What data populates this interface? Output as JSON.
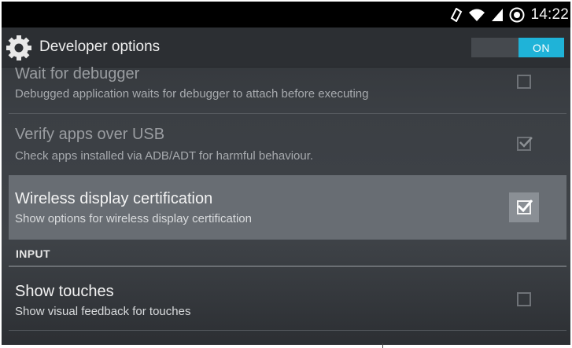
{
  "status_bar": {
    "time": "14:22",
    "icons": [
      "nfc-icon",
      "wifi-icon",
      "signal-icon",
      "sim-icon"
    ]
  },
  "action_bar": {
    "title": "Developer options",
    "icon": "gear-icon",
    "toggle_label": "ON",
    "toggle_state": "on",
    "accent_color": "#1fb3d8"
  },
  "settings": [
    {
      "title": "Wait for debugger",
      "summary": "Debugged application waits for debugger to attach before executing",
      "checked": false,
      "enabled": false
    },
    {
      "title": "Verify apps over USB",
      "summary": "Check apps installed via ADB/ADT for harmful behaviour.",
      "checked": true,
      "enabled": false
    },
    {
      "title": "Wireless display certification",
      "summary": "Show options for wireless display certification",
      "checked": true,
      "enabled": true,
      "highlighted": true
    }
  ],
  "section": {
    "header": "INPUT"
  },
  "input_settings": [
    {
      "title": "Show touches",
      "summary": "Show visual feedback for touches",
      "checked": false,
      "enabled": true
    }
  ]
}
